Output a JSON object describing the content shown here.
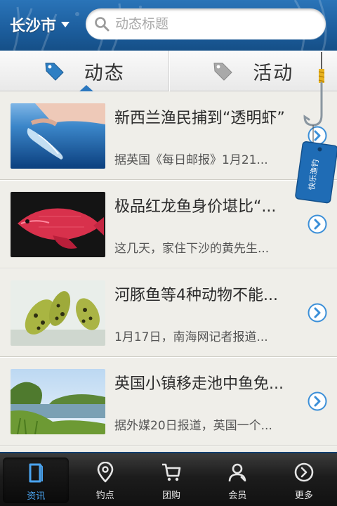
{
  "header": {
    "city": "长沙市",
    "search_placeholder": "动态标题"
  },
  "tabs": [
    {
      "label": "动态",
      "active": true
    },
    {
      "label": "活动",
      "active": false
    }
  ],
  "articles": [
    {
      "title": "新西兰渔民捕到“透明虾”",
      "summary": "据英国《每日邮报》1月21..."
    },
    {
      "title": "极品红龙鱼身价堪比“...",
      "summary": "这几天，家住下沙的黄先生..."
    },
    {
      "title": "河豚鱼等4种动物不能...",
      "summary": "1月17日，南海网记者报道..."
    },
    {
      "title": "英国小镇移走池中鱼免...",
      "summary": "据外媒20日报道，英国一个..."
    }
  ],
  "badge": {
    "text": "快乐渔钓"
  },
  "bottom_nav": [
    {
      "label": "资讯",
      "icon": "news-icon",
      "active": true
    },
    {
      "label": "钓点",
      "icon": "location-pin-icon",
      "active": false
    },
    {
      "label": "团购",
      "icon": "cart-icon",
      "active": false
    },
    {
      "label": "会员",
      "icon": "user-icon",
      "active": false
    },
    {
      "label": "更多",
      "icon": "more-arrow-icon",
      "active": false
    }
  ],
  "colors": {
    "header_blue": "#1d5f9f",
    "accent_blue": "#2b77bf",
    "active_nav": "#4aa3ee"
  }
}
